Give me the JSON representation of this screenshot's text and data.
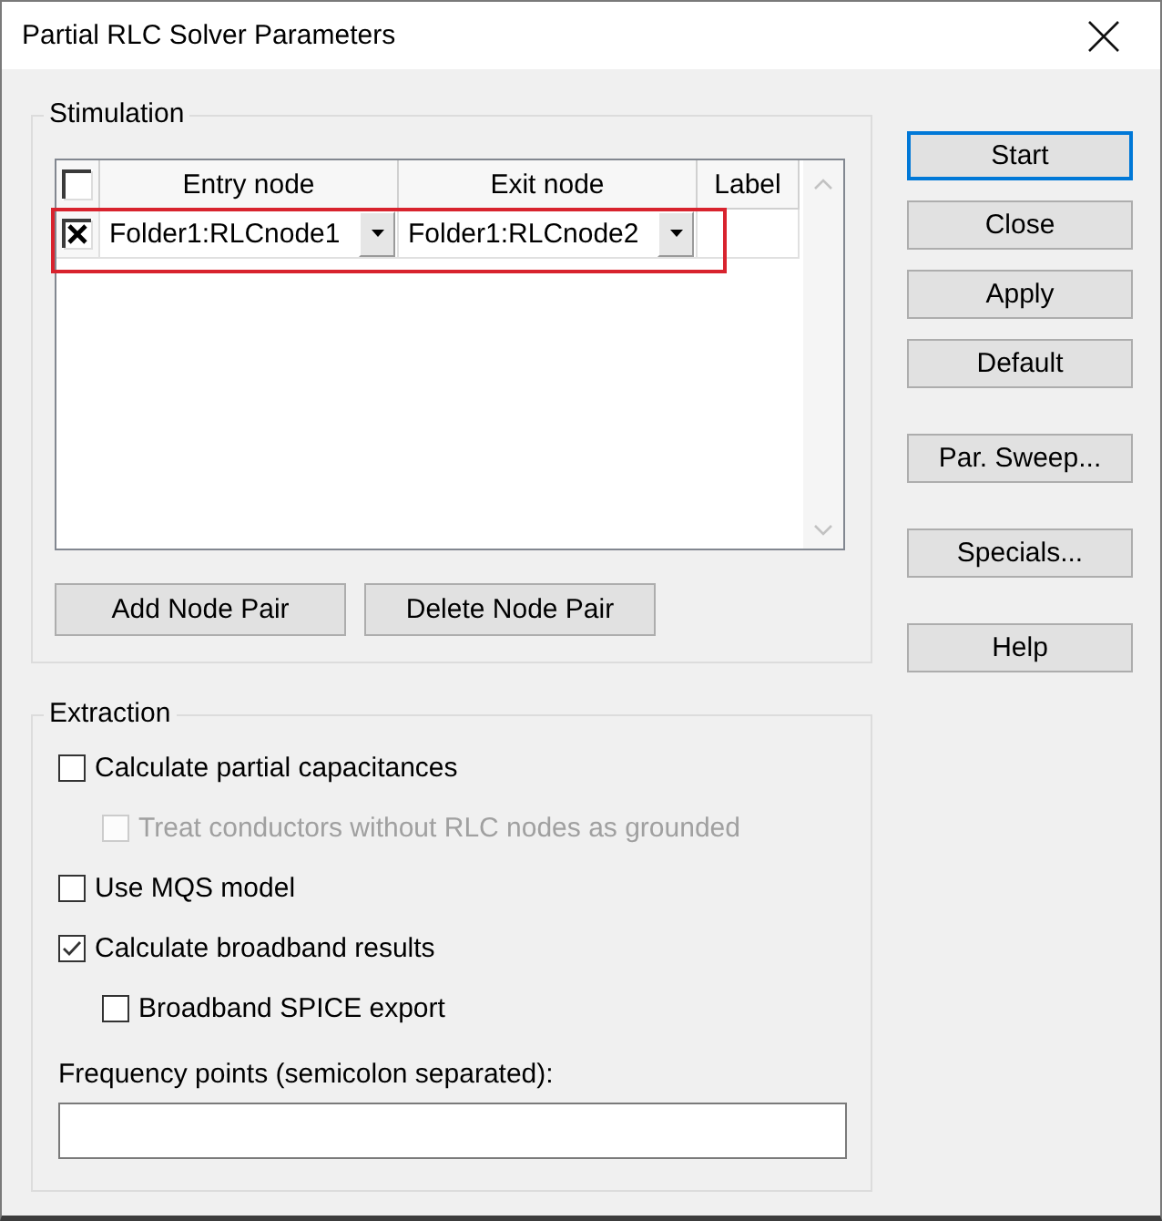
{
  "window": {
    "title": "Partial RLC Solver Parameters"
  },
  "stimulation": {
    "title": "Stimulation",
    "table": {
      "header_checked": false,
      "columns": [
        "Entry node",
        "Exit node",
        "Label"
      ],
      "rows": [
        {
          "checked": true,
          "entry_node": "Folder1:RLCnode1",
          "exit_node": "Folder1:RLCnode2",
          "highlighted": true
        }
      ]
    },
    "buttons": [
      "Add Node Pair",
      "Delete Node Pair"
    ]
  },
  "extraction": {
    "title": "Extraction",
    "options": [
      {
        "label": "Calculate partial capacitances",
        "checked": false,
        "disabled": false,
        "children": [
          {
            "label": "Treat conductors without RLC nodes as grounded",
            "checked": false,
            "disabled": true
          }
        ]
      },
      {
        "label": "Use MQS model",
        "checked": false,
        "disabled": false
      },
      {
        "label": "Calculate broadband results",
        "checked": true,
        "disabled": false,
        "children": [
          {
            "label": "Broadband SPICE export",
            "checked": false,
            "disabled": false
          }
        ]
      }
    ],
    "frequency_points": {
      "label": "Frequency points (semicolon separated):"
    }
  },
  "side_buttons": [
    [
      {
        "label": "Start",
        "focused": true
      },
      {
        "label": "Close",
        "focused": false
      },
      {
        "label": "Apply",
        "focused": false
      },
      {
        "label": "Default",
        "focused": false
      }
    ],
    [
      {
        "label": "Par. Sweep...",
        "focused": false
      }
    ],
    [
      {
        "label": "Specials...",
        "focused": false
      }
    ],
    [
      {
        "label": "Help",
        "focused": false
      }
    ]
  ]
}
